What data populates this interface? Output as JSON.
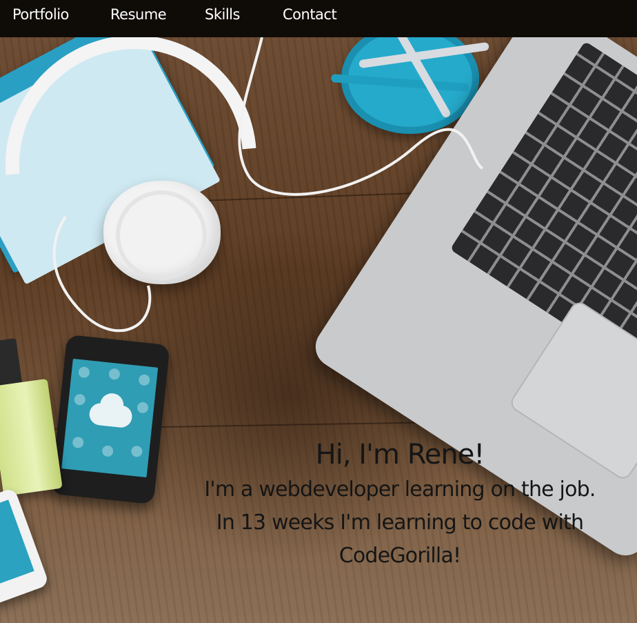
{
  "nav": {
    "items": [
      {
        "label": "Portfolio"
      },
      {
        "label": "Resume"
      },
      {
        "label": "Skills"
      },
      {
        "label": "Contact"
      }
    ]
  },
  "hero": {
    "title": "Hi, I'm Rene!",
    "line1": "I'm a webdeveloper learning on the job.",
    "line2": "In 13 weeks I'm learning to code with",
    "line3": "CodeGorilla!"
  },
  "colors": {
    "navbar": "#0f0c08",
    "nav_text": "#ffffff",
    "hero_text": "#151515",
    "wood": "#5c3b22"
  }
}
